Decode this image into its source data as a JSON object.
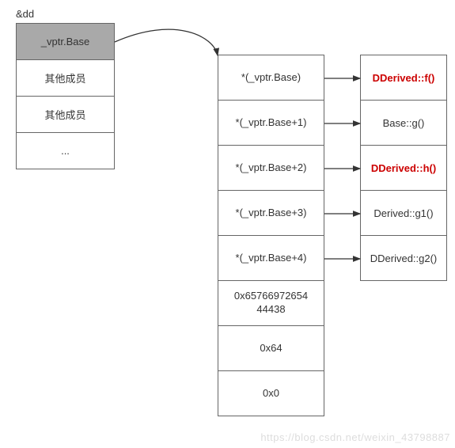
{
  "label_dd": "&dd",
  "object_cells": {
    "vptr": "_vptr.Base",
    "member1": "其他成员",
    "member2": "其他成员",
    "ellipsis": "..."
  },
  "vtable_cells": [
    "*(_vptr.Base)",
    "*(_vptr.Base+1)",
    "*(_vptr.Base+2)",
    "*(_vptr.Base+3)",
    "*(_vptr.Base+4)",
    "0x65766972654\n44438",
    "0x64",
    "0x0"
  ],
  "func_cells": [
    {
      "text": "DDerived::f()",
      "highlight": true
    },
    {
      "text": "Base::g()",
      "highlight": false
    },
    {
      "text": "DDerived::h()",
      "highlight": true
    },
    {
      "text": "Derived::g1()",
      "highlight": false
    },
    {
      "text": "DDerived::g2()",
      "highlight": false
    }
  ],
  "watermark": "https://blog.csdn.net/weixin_43798887"
}
